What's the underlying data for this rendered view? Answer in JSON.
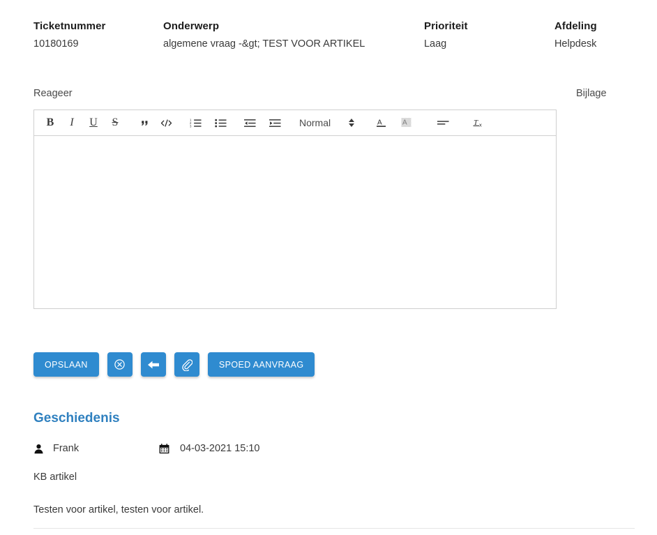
{
  "ticket": {
    "fields": [
      {
        "label": "Ticketnummer",
        "value": "10180169"
      },
      {
        "label": "Onderwerp",
        "value": "algemene vraag -&gt; TEST VOOR ARTIKEL"
      },
      {
        "label": "Prioriteit",
        "value": "Laag"
      },
      {
        "label": "Afdeling",
        "value": "Helpdesk"
      }
    ]
  },
  "reply": {
    "label": "Reageer",
    "attachment_label": "Bijlage",
    "content": "",
    "placeholder": ""
  },
  "toolbar": {
    "bold": "B",
    "italic": "I",
    "underline": "U",
    "strike": "S",
    "blockquote": "”",
    "code": "</>",
    "ordered_list": "ordered-list-icon",
    "bullet_list": "bullet-list-icon",
    "outdent": "outdent-icon",
    "indent": "indent-icon",
    "heading_value": "Normal",
    "text_color": "A",
    "highlight_color": "highlight-icon",
    "align": "align-icon",
    "clear_format": "Tx"
  },
  "actions": {
    "save": "OPSLAAN",
    "cancel": "cancel-circle-icon",
    "back": "back-arrow-icon",
    "attach": "paperclip-icon",
    "urgent": "SPOED AANVRAAG"
  },
  "history": {
    "title": "Geschiedenis",
    "entries": [
      {
        "user": "Frank",
        "date": "04-03-2021 15:10",
        "subject": "KB artikel",
        "body": "Testen voor artikel, testen voor artikel."
      }
    ]
  },
  "colors": {
    "accent": "#2f8bd0",
    "heading": "#2f80bf",
    "border": "#cfcfcf",
    "text": "#3a3a3a"
  }
}
